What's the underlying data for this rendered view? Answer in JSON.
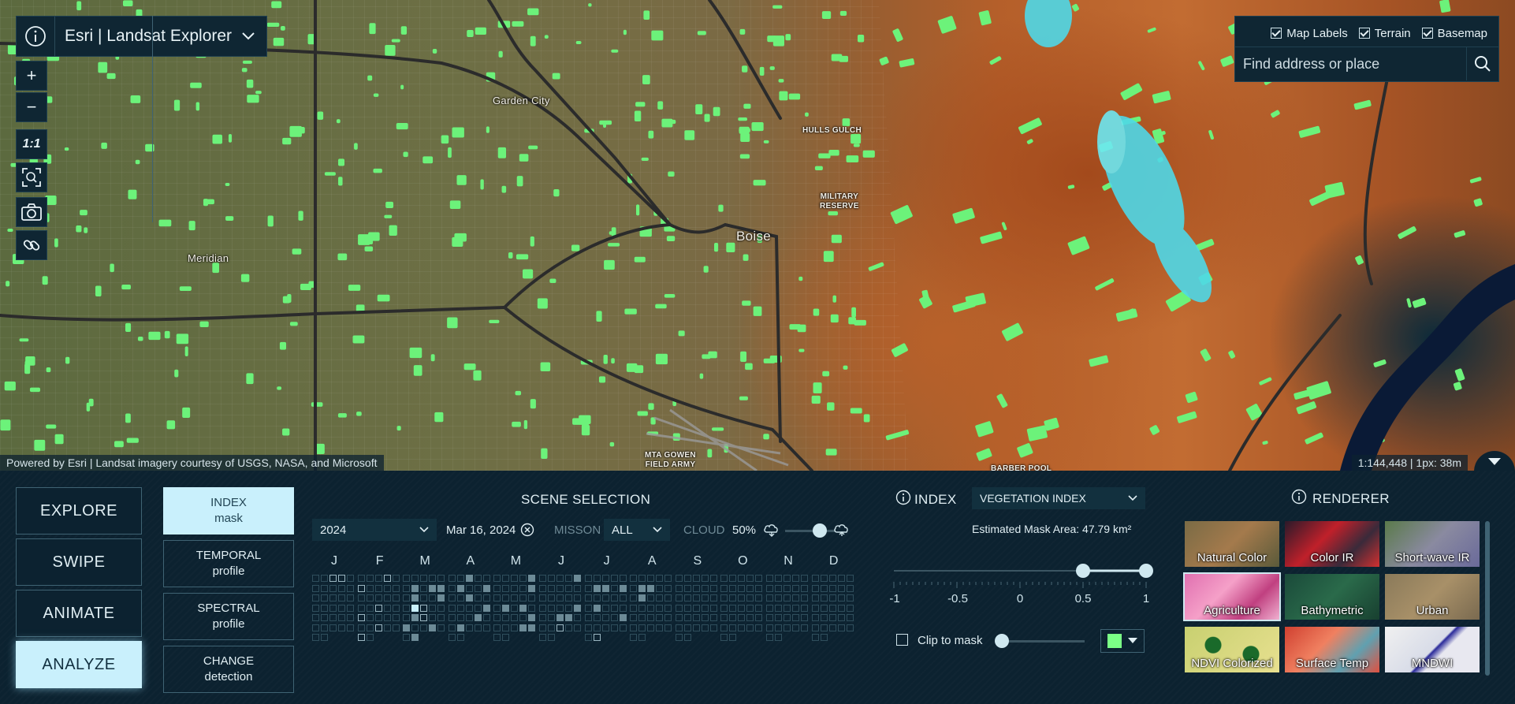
{
  "app": {
    "title": "Esri | Landsat Explorer"
  },
  "map": {
    "labels": [
      "Garden City",
      "HULLS GULCH",
      "MILITARY\nRESERVE",
      "Boise",
      "Meridian",
      "MTA GOWEN\nFIELD ARMY",
      "BARBER POOL"
    ],
    "attribution": "Powered by Esri | Landsat imagery courtesy of USGS, NASA, and Microsoft",
    "scale": "1:144,448 | 1px: 38m",
    "zoom_in": "+",
    "zoom_out": "−",
    "one_to_one": "1:1",
    "layers": [
      {
        "label": "Map Labels",
        "checked": true
      },
      {
        "label": "Terrain",
        "checked": true
      },
      {
        "label": "Basemap",
        "checked": true
      }
    ],
    "search_placeholder": "Find address or place"
  },
  "modes": [
    "EXPLORE",
    "SWIPE",
    "ANIMATE",
    "ANALYZE"
  ],
  "active_mode": "ANALYZE",
  "tools": [
    {
      "title": "INDEX",
      "sub": "mask"
    },
    {
      "title": "TEMPORAL",
      "sub": "profile"
    },
    {
      "title": "SPECTRAL",
      "sub": "profile"
    },
    {
      "title": "CHANGE",
      "sub": "detection"
    }
  ],
  "scene_selection": {
    "title": "SCENE SELECTION",
    "year": "2024",
    "date": "Mar 16, 2024",
    "mission_label": "MISSON",
    "mission_value": "ALL",
    "cloud_label": "CLOUD",
    "cloud_value": "50%",
    "cloud_level": 0.5,
    "months": [
      "J",
      "F",
      "M",
      "A",
      "M",
      "J",
      "J",
      "A",
      "S",
      "O",
      "N",
      "D"
    ]
  },
  "index": {
    "title": "INDEX",
    "selected": "VEGETATION INDEX",
    "estimated_area": "Estimated Mask Area: 47.79 km²",
    "range": [
      0.5,
      1
    ],
    "ticks": [
      "-1",
      "-0.5",
      "0",
      "0.5",
      "1"
    ],
    "clip_label": "Clip to mask",
    "clip_checked": false,
    "mask_color": "#7bff86"
  },
  "renderer": {
    "title": "RENDERER",
    "tiles": [
      "Natural Color",
      "Color IR",
      "Short-wave IR",
      "Agriculture",
      "Bathymetric",
      "Urban",
      "NDVI Colorized",
      "Surface Temp",
      "MNDWI"
    ],
    "selected": "Agriculture"
  },
  "colors": {
    "accent": "#c9f0fc",
    "panel_bg": "#0c2230",
    "vegetation": "#6cf27a"
  }
}
